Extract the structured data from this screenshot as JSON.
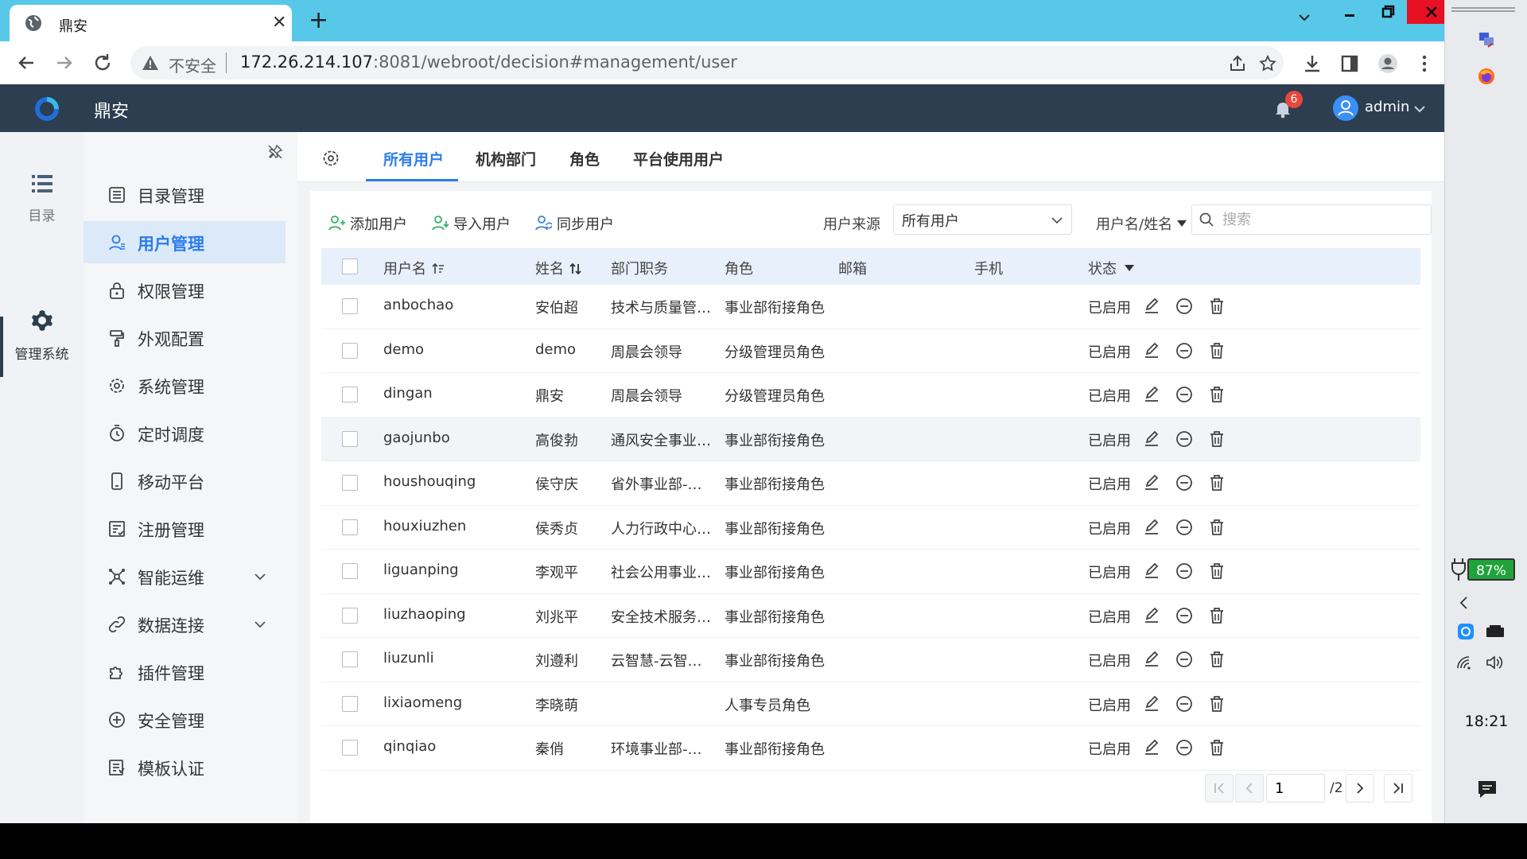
{
  "browser": {
    "tab_title": "鼎安",
    "url_warning": "不安全",
    "url_host": "172.26.214.107",
    "url_rest": ":8081/webroot/decision#management/user"
  },
  "app": {
    "name": "鼎安",
    "notification_count": "6",
    "user": "admin"
  },
  "rail": [
    {
      "label": "目录"
    },
    {
      "label": "管理系统"
    }
  ],
  "menu": [
    {
      "label": "目录管理"
    },
    {
      "label": "用户管理"
    },
    {
      "label": "权限管理"
    },
    {
      "label": "外观配置"
    },
    {
      "label": "系统管理"
    },
    {
      "label": "定时调度"
    },
    {
      "label": "移动平台"
    },
    {
      "label": "注册管理"
    },
    {
      "label": "智能运维"
    },
    {
      "label": "数据连接"
    },
    {
      "label": "插件管理"
    },
    {
      "label": "安全管理"
    },
    {
      "label": "模板认证"
    }
  ],
  "tabs": [
    {
      "label": "所有用户"
    },
    {
      "label": "机构部门"
    },
    {
      "label": "角色"
    },
    {
      "label": "平台使用用户"
    }
  ],
  "toolbar": {
    "add_user": "添加用户",
    "import_user": "导入用户",
    "sync_user": "同步用户",
    "source_label": "用户来源",
    "source_value": "所有用户",
    "search_field": "用户名/姓名",
    "search_placeholder": "搜索"
  },
  "table": {
    "columns": [
      "用户名",
      "姓名",
      "部门职务",
      "角色",
      "邮箱",
      "手机",
      "状态"
    ],
    "rows": [
      {
        "username": "anbochao",
        "name": "安伯超",
        "dept": "技术与质量管理…",
        "role": "事业部衔接角色",
        "status": "已启用"
      },
      {
        "username": "demo",
        "name": "demo",
        "dept": "周晨会领导",
        "role": "分级管理员角色",
        "status": "已启用"
      },
      {
        "username": "dingan",
        "name": "鼎安",
        "dept": "周晨会领导",
        "role": "分级管理员角色",
        "status": "已启用"
      },
      {
        "username": "gaojunbo",
        "name": "高俊勃",
        "dept": "通风安全事业部-…",
        "role": "事业部衔接角色",
        "status": "已启用"
      },
      {
        "username": "houshouqing",
        "name": "侯守庆",
        "dept": "省外事业部-事业…",
        "role": "事业部衔接角色",
        "status": "已启用"
      },
      {
        "username": "houxiuzhen",
        "name": "侯秀贞",
        "dept": "人力行政中心-人…",
        "role": "事业部衔接角色",
        "status": "已启用"
      },
      {
        "username": "liguanping",
        "name": "李观平",
        "dept": "社会公用事业部-…",
        "role": "事业部衔接角色",
        "status": "已启用"
      },
      {
        "username": "liuzhaoping",
        "name": "刘兆平",
        "dept": "安全技术服务事…",
        "role": "事业部衔接角色",
        "status": "已启用"
      },
      {
        "username": "liuzunli",
        "name": "刘遵利",
        "dept": "云智慧-云智慧经理",
        "role": "事业部衔接角色",
        "status": "已启用"
      },
      {
        "username": "lixiaomeng",
        "name": "李晓萌",
        "dept": "",
        "role": "人事专员角色",
        "status": "已启用"
      },
      {
        "username": "qinqiao",
        "name": "秦俏",
        "dept": "环境事业部-事业…",
        "role": "事业部衔接角色",
        "status": "已启用"
      }
    ]
  },
  "pagination": {
    "current": "1",
    "total": "/2"
  },
  "taskbar": {
    "battery": "87%",
    "time": "18:21"
  },
  "colors": {
    "accent": "#2b7de9",
    "header": "#2c3e50",
    "browser_tabbar": "#58c8e8",
    "success_icon": "#2fb36a"
  }
}
